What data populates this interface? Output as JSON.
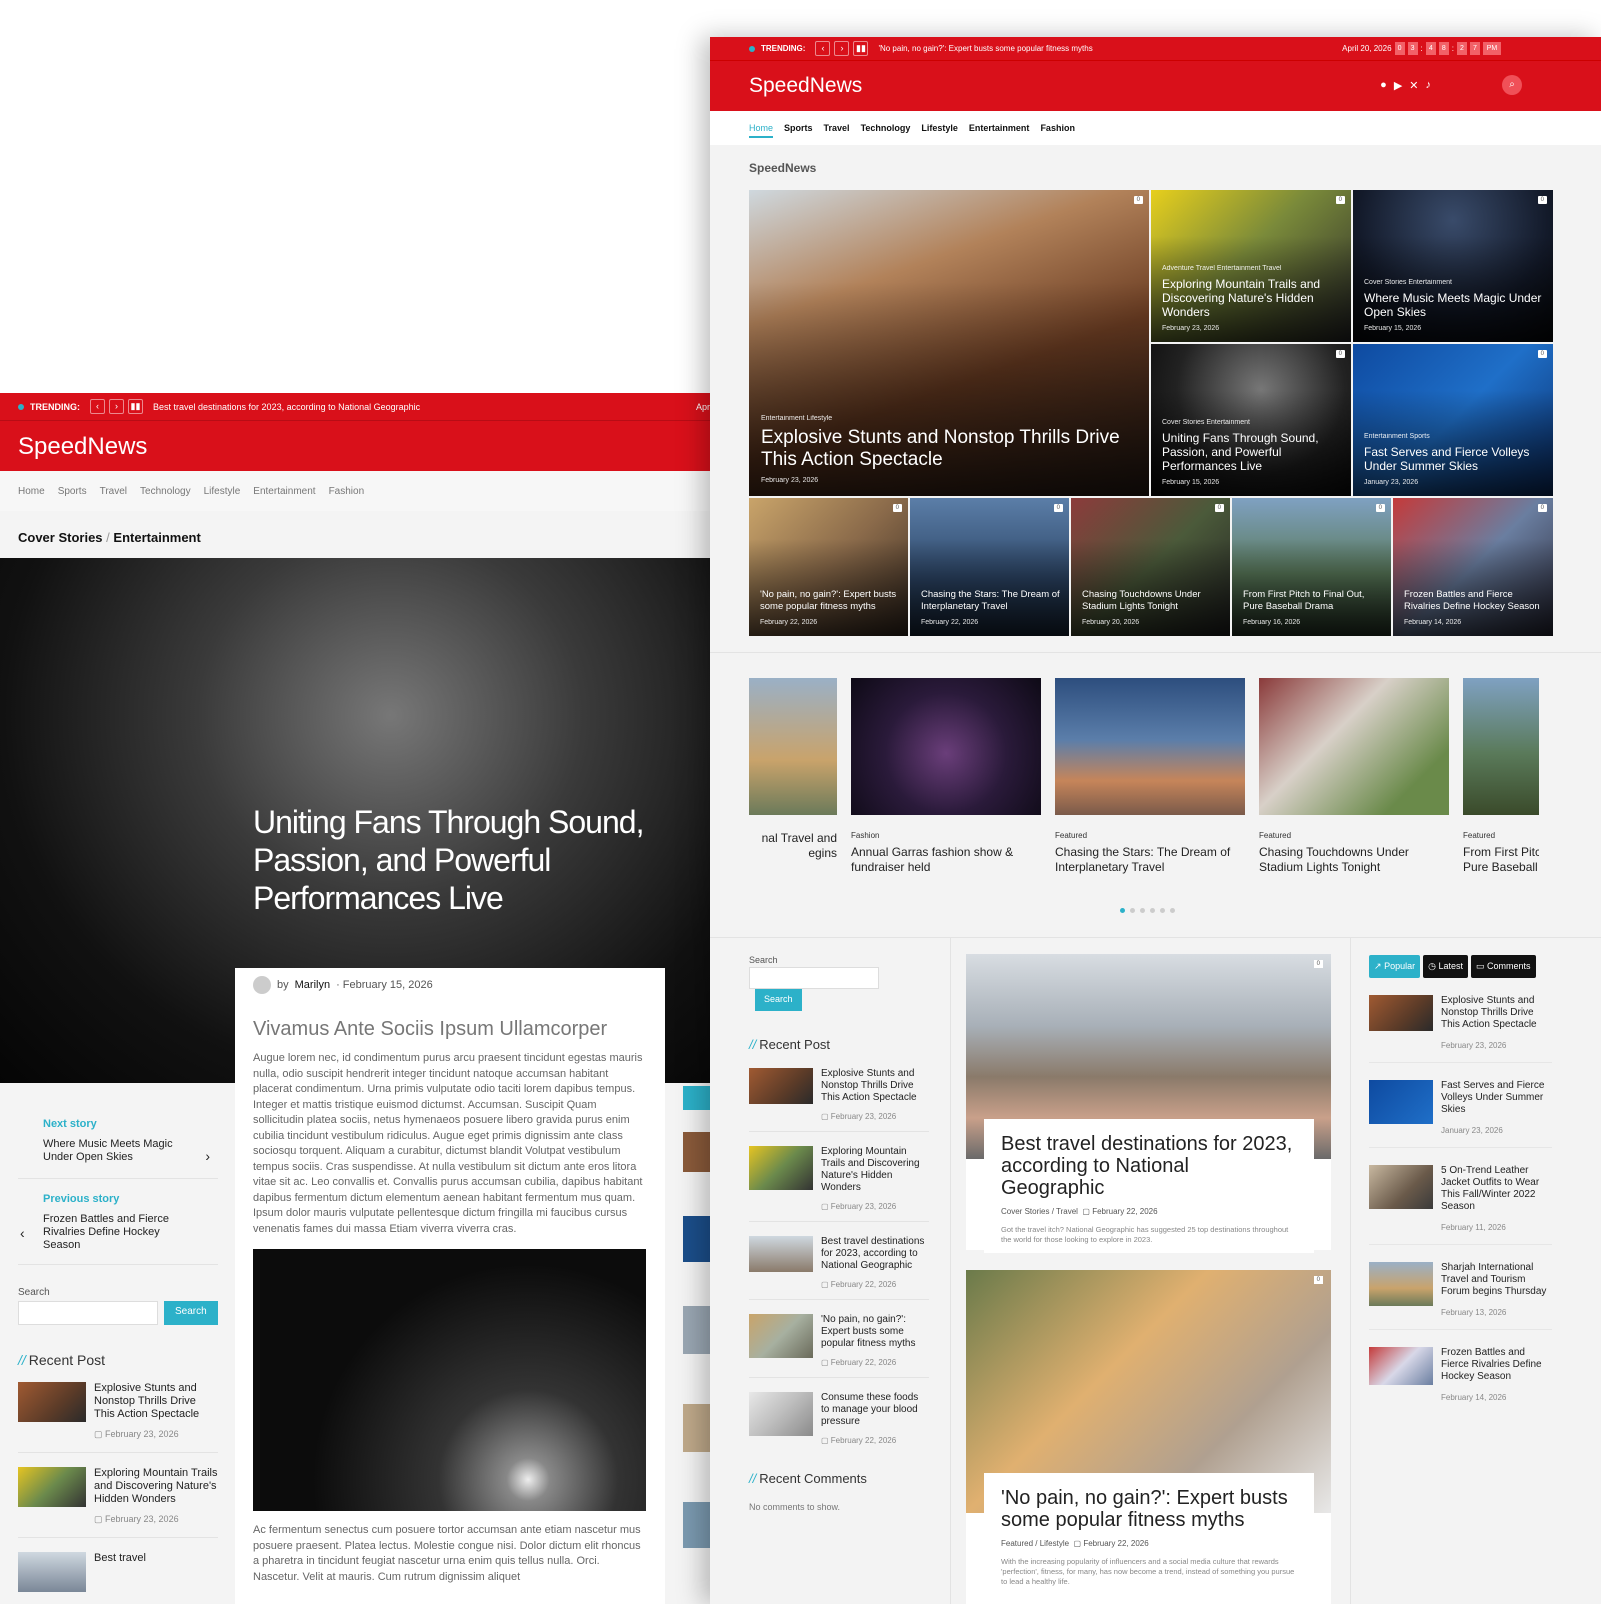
{
  "back": {
    "trending_label": "TRENDING:",
    "trending_text": "Best travel destinations for 2023, according to National Geographic",
    "trending_date_partial": "Apr",
    "brand": "SpeedNews",
    "nav": [
      "Home",
      "Sports",
      "Travel",
      "Technology",
      "Lifestyle",
      "Entertainment",
      "Fashion"
    ],
    "crumb_a": "Cover Stories",
    "crumb_sep": "/",
    "crumb_b": "Entertainment",
    "hero_title": "Uniting Fans Through Sound, Passion, and Powerful Performances Live",
    "meta_by": "by",
    "meta_author": "Marilyn",
    "meta_date": "· February 15, 2026",
    "article_heading": "Vivamus Ante Sociis Ipsum Ullamcorper",
    "article_p1": "Augue lorem nec, id condimentum purus arcu praesent tincidunt egestas mauris nulla, odio suscipit hendrerit integer tincidunt natoque accumsan habitant placerat condimentum. Urna primis vulputate odio taciti lorem dapibus tempus. Integer et mattis tristique euismod dictumst. Accumsan. Suscipit Quam sollicitudin platea sociis, netus hymenaeos posuere libero gravida purus enim cubilia tincidunt vestibulum ridiculus. Augue eget primis dignissim ante class sociosqu torquent. Aliquam a curabitur, dictumst blandit Volutpat vestibulum tempus sociis. Cras suspendisse. At nulla vestibulum sit dictum ante eros litora vitae sit ac. Leo convallis et. Convallis purus accumsan cubilia, dapibus habitant dapibus fermentum dictum elementum aenean habitant fermentum mus quam. Ipsum dolor mauris vulputate pellentesque dictum fringilla mi faucibus cursus venenatis fames dui massa Etiam viverra viverra cras.",
    "article_p2": "Ac fermentum senectus cum posuere tortor accumsan ante etiam nascetur mus posuere praesent. Platea lectus. Molestie congue nisi. Dolor dictum elit rhoncus a pharetra in tincidunt feugiat nascetur urna enim quis tellus nulla. Orci. Nascetur. Velit at mauris. Cum rutrum dignissim aliquet",
    "next_label": "Next story",
    "next_title": "Where Music Meets Magic Under Open Skies",
    "prev_label": "Previous story",
    "prev_title": "Frozen Battles and Fierce Rivalries Define Hockey Season",
    "search_label": "Search",
    "search_button": "Search",
    "recent_heading": "Recent Post",
    "recent": [
      {
        "title": "Explosive Stunts and Nonstop Thrills Drive This Action Spectacle",
        "date": "February 23, 2026"
      },
      {
        "title": "Exploring Mountain Trails and Discovering Nature's Hidden Wonders",
        "date": "February 23, 2026"
      },
      {
        "title": "Best travel",
        "date": ""
      }
    ]
  },
  "front": {
    "trending_label": "TRENDING:",
    "trending_text": "'No pain, no gain?': Expert busts some popular fitness myths",
    "date": "April 20, 2026",
    "clock_digits": [
      "0",
      "3",
      "4",
      "8",
      "2",
      "7"
    ],
    "clock_ampm": "PM",
    "brand": "SpeedNews",
    "nav": [
      "Home",
      "Sports",
      "Travel",
      "Technology",
      "Lifestyle",
      "Entertainment",
      "Fashion"
    ],
    "section_title": "SpeedNews",
    "comment_count": "0",
    "hero": {
      "cat": "Entertainment Lifestyle",
      "title": "Explosive Stunts and Nonstop Thrills Drive This Action Spectacle",
      "date": "February 23, 2026"
    },
    "grid": [
      {
        "cat": "Adventure Travel Entertainment Travel",
        "title": "Exploring Mountain Trails and Discovering Nature's Hidden Wonders",
        "date": "February 23, 2026"
      },
      {
        "cat": "Cover Stories Entertainment",
        "title": "Where Music Meets Magic Under Open Skies",
        "date": "February 15, 2026"
      },
      {
        "cat": "Cover Stories Entertainment",
        "title": "Uniting Fans Through Sound, Passion, and Powerful Performances Live",
        "date": "February 15, 2026"
      },
      {
        "cat": "Entertainment Sports",
        "title": "Fast Serves and Fierce Volleys Under Summer Skies",
        "date": "January 23, 2026"
      }
    ],
    "row": [
      {
        "title": "'No pain, no gain?': Expert busts some popular fitness myths",
        "date": "February 22, 2026"
      },
      {
        "title": "Chasing the Stars: The Dream of Interplanetary Travel",
        "date": "February 22, 2026"
      },
      {
        "title": "Chasing Touchdowns Under Stadium Lights Tonight",
        "date": "February 20, 2026"
      },
      {
        "title": "From First Pitch to Final Out, Pure Baseball Drama",
        "date": "February 16, 2026"
      },
      {
        "title": "Frozen Battles and Fierce Rivalries Define Hockey Season",
        "date": "February 14, 2026"
      }
    ],
    "carousel": [
      {
        "cat": "",
        "title": "nal Travel and\negins"
      },
      {
        "cat": "Fashion",
        "title": "Annual Garras fashion show & fundraiser held"
      },
      {
        "cat": "Featured",
        "title": "Chasing the Stars: The Dream of Interplanetary Travel"
      },
      {
        "cat": "Featured",
        "title": "Chasing Touchdowns Under Stadium Lights Tonight"
      },
      {
        "cat": "Featured",
        "title": "From First Pitch\nPure Baseball D"
      }
    ],
    "search_label": "Search",
    "search_button": "Search",
    "recent_heading": "Recent Post",
    "recent": [
      {
        "title": "Explosive Stunts and Nonstop Thrills Drive This Action Spectacle",
        "date": "February 23, 2026"
      },
      {
        "title": "Exploring Mountain Trails and Discovering Nature's Hidden Wonders",
        "date": "February 23, 2026"
      },
      {
        "title": "Best travel destinations for 2023, according to National Geographic",
        "date": "February 22, 2026"
      },
      {
        "title": "'No pain, no gain?': Expert busts some popular fitness myths",
        "date": "February 22, 2026"
      },
      {
        "title": "Consume these foods to manage your blood pressure",
        "date": "February 22, 2026"
      }
    ],
    "recent_comments_heading": "Recent Comments",
    "no_comments": "No comments to show.",
    "features": [
      {
        "title": "Best travel destinations for 2023, according to National Geographic",
        "cat_a": "Cover Stories",
        "cat_b": "Travel",
        "date": "February 22, 2026",
        "excerpt": "Got the travel itch? National Geographic has suggested 25 top destinations throughout the world for those looking to explore in 2023."
      },
      {
        "title": "'No pain, no gain?': Expert busts some popular fitness myths",
        "cat_a": "Featured",
        "cat_b": "Lifestyle",
        "date": "February 22, 2026",
        "excerpt": "With the increasing popularity of influencers and a social media culture that rewards 'perfection', fitness, for many, has now become a trend, instead of something you pursue to lead a healthy life."
      }
    ],
    "tabs": [
      "Popular",
      "Latest",
      "Comments"
    ],
    "popular": [
      {
        "title": "Explosive Stunts and Nonstop Thrills Drive This Action Spectacle",
        "date": "February 23, 2026"
      },
      {
        "title": "Fast Serves and Fierce Volleys Under Summer Skies",
        "date": "January 23, 2026"
      },
      {
        "title": "5 On-Trend Leather Jacket Outfits to Wear This Fall/Winter 2022 Season",
        "date": "February 11, 2026"
      },
      {
        "title": "Sharjah International Travel and Tourism Forum begins Thursday",
        "date": "February 13, 2026"
      },
      {
        "title": "Frozen Battles and Fierce Rivalries Define Hockey Season",
        "date": "February 14, 2026"
      }
    ]
  }
}
